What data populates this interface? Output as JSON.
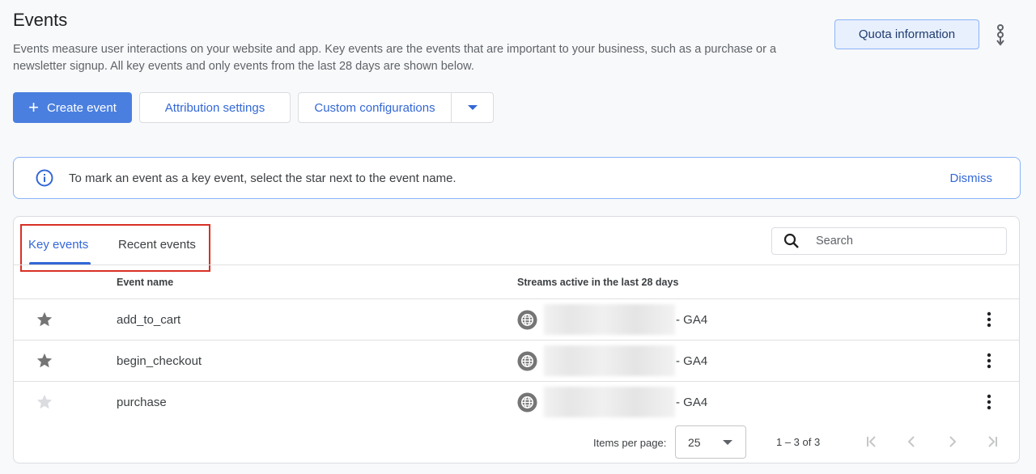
{
  "header": {
    "title": "Events",
    "description": "Events measure user interactions on your website and app. Key events are the events that are important to your business, such as a purchase or a newsletter signup. All key events and only events from the last 28 days are shown below.",
    "quota_label": "Quota information",
    "more_icon": "more-vert-icon"
  },
  "actions": {
    "create_label": "Create event",
    "attribution_label": "Attribution settings",
    "custom_label": "Custom configurations"
  },
  "banner": {
    "text": "To mark an event as a key event, select the star next to the event name.",
    "dismiss_label": "Dismiss",
    "icon": "info-icon"
  },
  "tabs": [
    {
      "label": "Key events",
      "active": true
    },
    {
      "label": "Recent events",
      "active": false
    }
  ],
  "search": {
    "placeholder": "Search"
  },
  "table": {
    "columns": [
      "Event name",
      "Streams active in the last 28 days"
    ],
    "rows": [
      {
        "name": "add_to_cart",
        "key_event": true,
        "stream_suffix": "- GA4"
      },
      {
        "name": "begin_checkout",
        "key_event": true,
        "stream_suffix": "- GA4"
      },
      {
        "name": "purchase",
        "key_event": false,
        "stream_suffix": "- GA4"
      }
    ]
  },
  "pagination": {
    "items_per_page_label": "Items per page:",
    "items_per_page": "25",
    "range": "1 – 3 of 3"
  },
  "colors": {
    "accent": "#3367d6",
    "primary_button": "#4a7fe0",
    "highlight_box": "#d93025",
    "star_active": "#757575",
    "star_inactive": "#dadce0"
  }
}
